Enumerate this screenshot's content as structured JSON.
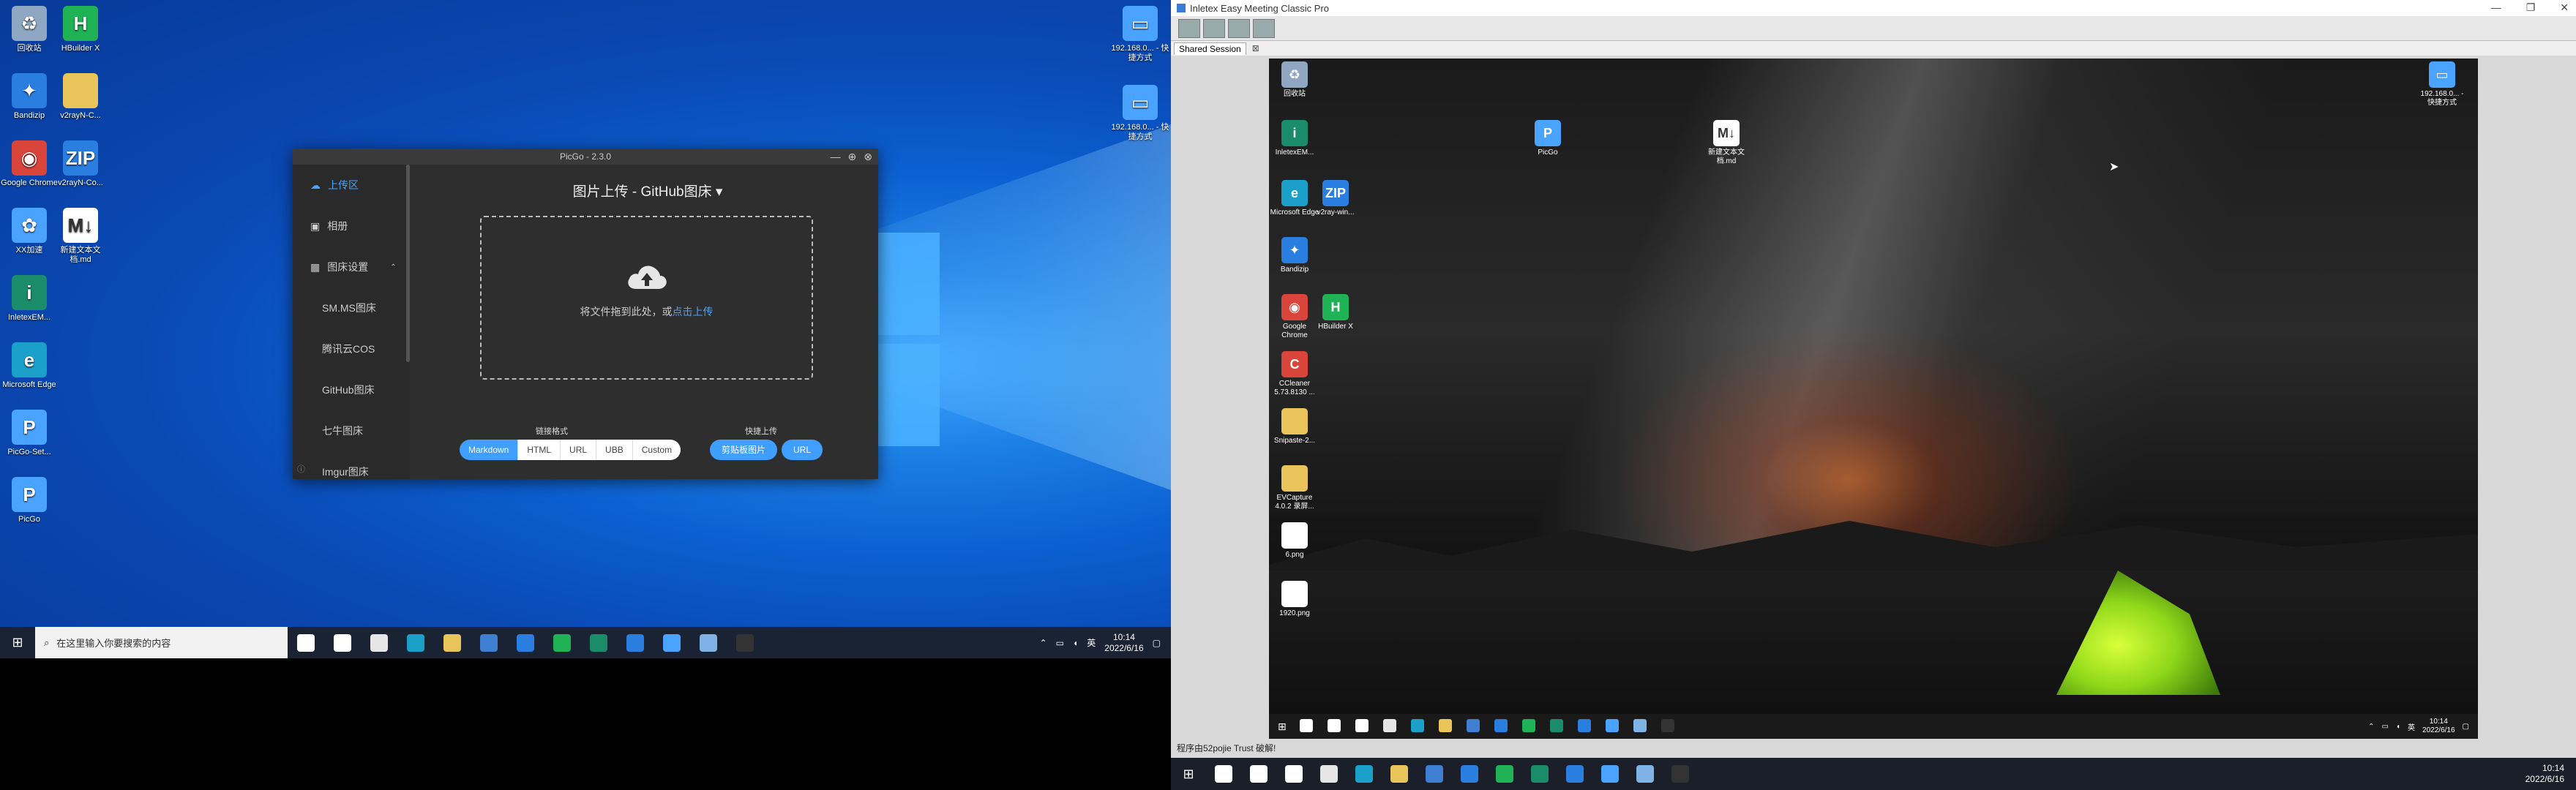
{
  "left_desktop": {
    "icons": [
      {
        "label": "回收站",
        "icon": "recycle-bin-icon",
        "color": "#8fa7c2"
      },
      {
        "label": "HBuilder X",
        "icon": "hbuilder-icon",
        "color": "#1fb355"
      },
      {
        "label": "Bandizip",
        "icon": "bandizip-icon",
        "color": "#2a7ee0"
      },
      {
        "label": "v2rayN-C...",
        "icon": "folder-icon",
        "color": "#e8c45a"
      },
      {
        "label": "Google Chrome",
        "icon": "chrome-icon",
        "color": "#d9453b"
      },
      {
        "label": "v2rayN-Co...",
        "icon": "zip-icon",
        "color": "#2a7ee0"
      },
      {
        "label": "XX加速",
        "icon": "app-icon",
        "color": "#4aa3ff"
      },
      {
        "label": "新建文本文档.md",
        "icon": "markdown-file-icon",
        "color": "#ffffff"
      },
      {
        "label": "InletexEM...",
        "icon": "inletex-icon",
        "color": "#1a8c6a"
      },
      {
        "label": "Microsoft Edge",
        "icon": "edge-icon",
        "color": "#1aa0c9"
      },
      {
        "label": "PicGo-Set...",
        "icon": "picgo-setup-icon",
        "color": "#4aa3ff"
      },
      {
        "label": "PicGo",
        "icon": "picgo-icon",
        "color": "#4aa3ff"
      }
    ],
    "right_icons": [
      {
        "label": "192.168.0... - 快捷方式",
        "icon": "network-shortcut-icon",
        "color": "#4aa3ff"
      },
      {
        "label": "192.168.0... - 快捷方式",
        "icon": "network-shortcut-icon",
        "color": "#4aa3ff"
      }
    ]
  },
  "picgo": {
    "title": "PicGo - 2.3.0",
    "sidebar": {
      "items": [
        {
          "label": "上传区",
          "icon": "upload-icon"
        },
        {
          "label": "相册",
          "icon": "album-icon"
        },
        {
          "label": "图床设置",
          "icon": "grid-icon"
        }
      ],
      "sub_items": [
        "SM.MS图床",
        "腾讯云COS",
        "GitHub图床",
        "七牛图床",
        "Imgur图床"
      ]
    },
    "heading": "图片上传 - GitHub图床",
    "drop_text": "将文件拖到此处，或",
    "drop_link": "点击上传",
    "link_format_label": "链接格式",
    "formats": [
      "Markdown",
      "HTML",
      "URL",
      "UBB",
      "Custom"
    ],
    "selected_format": "Markdown",
    "quick_upload_label": "快捷上传",
    "quick_buttons": [
      "剪贴板图片",
      "URL"
    ]
  },
  "left_taskbar": {
    "search_placeholder": "在这里输入你要搜索的内容",
    "time": "10:14",
    "date": "2022/6/16",
    "ime": "英",
    "apps": [
      {
        "name": "cortana-icon",
        "color": "#ffffff"
      },
      {
        "name": "task-view-icon",
        "color": "#ffffff"
      },
      {
        "name": "store-icon",
        "color": "#e6e6e6"
      },
      {
        "name": "edge-icon",
        "color": "#1aa0c9"
      },
      {
        "name": "explorer-icon",
        "color": "#e8c45a"
      },
      {
        "name": "mail-icon",
        "color": "#3f7fd1"
      },
      {
        "name": "bandizip-icon",
        "color": "#2a7ee0"
      },
      {
        "name": "hbuilder-icon",
        "color": "#1fb355"
      },
      {
        "name": "inletex-icon",
        "color": "#1a8c6a"
      },
      {
        "name": "v2ray-icon",
        "color": "#2a7ee0"
      },
      {
        "name": "picgo-icon",
        "color": "#4aa3ff"
      },
      {
        "name": "remote-app-icon",
        "color": "#7fb3e6"
      },
      {
        "name": "terminal-icon",
        "color": "#333333"
      }
    ]
  },
  "right_app": {
    "title": "Inletex Easy Meeting Classic Pro",
    "tab": "Shared Session",
    "status": "程序由52pojie Trust 破解!"
  },
  "remote_desktop": {
    "icons": [
      {
        "label": "回收站",
        "icon": "recycle-bin-icon",
        "color": "#8fa7c2"
      },
      {
        "label": "InletexEM...",
        "icon": "inletex-icon",
        "color": "#1a8c6a"
      },
      {
        "label": "Microsoft Edge",
        "icon": "edge-icon",
        "color": "#1aa0c9"
      },
      {
        "label": "v2ray-win...",
        "icon": "zip-icon",
        "color": "#2a7ee0"
      },
      {
        "label": "Bandizip",
        "icon": "bandizip-icon",
        "color": "#2a7ee0"
      },
      {
        "label": "Google Chrome",
        "icon": "chrome-icon",
        "color": "#d9453b"
      },
      {
        "label": "HBuilder X",
        "icon": "hbuilder-icon",
        "color": "#1fb355"
      },
      {
        "label": "CCleaner 5.73.8130 ...",
        "icon": "ccleaner-icon",
        "color": "#d9453b"
      },
      {
        "label": "Snipaste-2...",
        "icon": "folder-icon",
        "color": "#e8c45a"
      },
      {
        "label": "EVCapture 4.0.2 录屏...",
        "icon": "folder-icon",
        "color": "#e8c45a"
      },
      {
        "label": "6.png",
        "icon": "image-file-icon",
        "color": "#ffffff"
      },
      {
        "label": "1920.png",
        "icon": "image-file-icon",
        "color": "#ffffff"
      },
      {
        "label": "PicGo",
        "icon": "picgo-icon",
        "color": "#4aa3ff"
      },
      {
        "label": "新建文本文档.md",
        "icon": "markdown-file-icon",
        "color": "#ffffff"
      },
      {
        "label": "192.168.0... - 快捷方式",
        "icon": "network-shortcut-icon",
        "color": "#4aa3ff"
      }
    ],
    "time": "10:14",
    "date": "2022/6/16",
    "ime": "英"
  },
  "right_taskbar": {
    "time": "10:14",
    "date": "2022/6/16",
    "apps": [
      {
        "name": "search-icon",
        "color": "#ffffff"
      },
      {
        "name": "cortana-icon",
        "color": "#ffffff"
      },
      {
        "name": "task-view-icon",
        "color": "#ffffff"
      },
      {
        "name": "store-icon",
        "color": "#e6e6e6"
      },
      {
        "name": "edge-icon",
        "color": "#1aa0c9"
      },
      {
        "name": "explorer-icon",
        "color": "#e8c45a"
      },
      {
        "name": "mail-icon",
        "color": "#3f7fd1"
      },
      {
        "name": "bandizip-icon",
        "color": "#2a7ee0"
      },
      {
        "name": "hbuilder-icon",
        "color": "#1fb355"
      },
      {
        "name": "inletex-icon",
        "color": "#1a8c6a"
      },
      {
        "name": "v2ray-icon",
        "color": "#2a7ee0"
      },
      {
        "name": "picgo-icon",
        "color": "#4aa3ff"
      },
      {
        "name": "remote-app-icon",
        "color": "#7fb3e6"
      },
      {
        "name": "terminal-icon",
        "color": "#333333"
      }
    ]
  }
}
